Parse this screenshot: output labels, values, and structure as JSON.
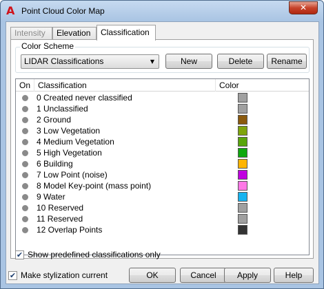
{
  "window": {
    "title": "Point Cloud Color Map",
    "close_glyph": "✕",
    "app_icon": "autocad-a-icon",
    "app_glyph": "A"
  },
  "tabs": [
    {
      "label": "Intensity",
      "state": "disabled"
    },
    {
      "label": "Elevation",
      "state": "normal"
    },
    {
      "label": "Classification",
      "state": "active"
    }
  ],
  "color_scheme": {
    "group_label": "Color Scheme",
    "selected": "LIDAR Classifications",
    "arrow": "▼",
    "new_label": "New",
    "delete_label": "Delete",
    "rename_label": "Rename"
  },
  "grid": {
    "col_on": "On",
    "col_classification": "Classification",
    "col_color": "Color",
    "rows": [
      {
        "label": "0 Created never classified",
        "color": "#a0a0a0"
      },
      {
        "label": "1 Unclassified",
        "color": "#a0a0a0"
      },
      {
        "label": "2 Ground",
        "color": "#8b5a0e"
      },
      {
        "label": "3 Low Vegetation",
        "color": "#7fa50d"
      },
      {
        "label": "4 Medium Vegetation",
        "color": "#59a60c"
      },
      {
        "label": "5 High Vegetation",
        "color": "#0fa80e"
      },
      {
        "label": "6 Building",
        "color": "#ffb400"
      },
      {
        "label": "7 Low Point (noise)",
        "color": "#c000e0"
      },
      {
        "label": "8 Model Key-point (mass point)",
        "color": "#ff78e6"
      },
      {
        "label": "9 Water",
        "color": "#18b4f0"
      },
      {
        "label": "10 Reserved",
        "color": "#a0a0a0"
      },
      {
        "label": "11 Reserved",
        "color": "#a0a0a0"
      },
      {
        "label": "12 Overlap Points",
        "color": "#333333"
      }
    ]
  },
  "show_predefined": {
    "label": "Show predefined classifications only",
    "checked": true
  },
  "make_current": {
    "label": "Make stylization current",
    "checked": true
  },
  "footer": {
    "ok_label": "OK",
    "cancel_label": "Cancel",
    "apply_label": "Apply",
    "help_label": "Help"
  },
  "check_glyph": "✔"
}
